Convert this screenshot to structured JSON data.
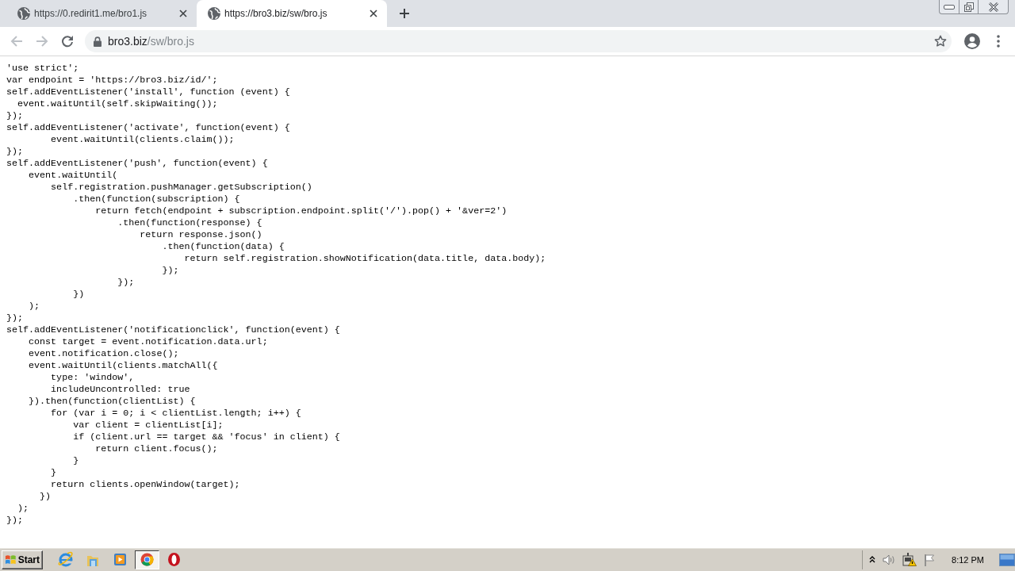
{
  "tabs": [
    {
      "title": "https://0.redirit1.me/bro1.js",
      "selected": false
    },
    {
      "title": "https://bro3.biz/sw/bro.js",
      "selected": true
    }
  ],
  "nav_buttons": [
    {
      "kind": "back",
      "disabled": true
    },
    {
      "kind": "forward",
      "disabled": true
    },
    {
      "kind": "reload",
      "disabled": false
    }
  ],
  "address_bar": {
    "host": "bro3.biz",
    "path": "/sw/bro.js"
  },
  "code_lines": [
    "'use strict';",
    "var endpoint = 'https://bro3.biz/id/';",
    "self.addEventListener('install', function (event) {",
    "  event.waitUntil(self.skipWaiting());",
    "});",
    "self.addEventListener('activate', function(event) {",
    "        event.waitUntil(clients.claim());",
    "});",
    "self.addEventListener('push', function(event) {",
    "    event.waitUntil(",
    "        self.registration.pushManager.getSubscription()",
    "            .then(function(subscription) {",
    "                return fetch(endpoint + subscription.endpoint.split('/').pop() + '&ver=2')",
    "                    .then(function(response) {",
    "                        return response.json()",
    "                            .then(function(data) {",
    "                                return self.registration.showNotification(data.title, data.body);",
    "                            });",
    "                    });",
    "            })",
    "    );",
    "});",
    "self.addEventListener('notificationclick', function(event) {",
    "    const target = event.notification.data.url;",
    "    event.notification.close();",
    "    event.waitUntil(clients.matchAll({",
    "        type: 'window',",
    "        includeUncontrolled: true",
    "    }).then(function(clientList) {",
    "        for (var i = 0; i < clientList.length; i++) {",
    "            var client = clientList[i];",
    "            if (client.url == target && 'focus' in client) {",
    "                return client.focus();",
    "            }",
    "        }",
    "        return clients.openWindow(target);",
    "      })",
    "  );",
    "});"
  ],
  "taskbar": {
    "start": "Start",
    "apps": [
      {
        "kind": "e",
        "selected": false
      },
      {
        "kind": "folder",
        "selected": false
      },
      {
        "kind": "player",
        "selected": false
      },
      {
        "kind": "ring",
        "selected": true
      },
      {
        "kind": "o",
        "selected": false
      }
    ],
    "clock": "8:12 PM"
  }
}
